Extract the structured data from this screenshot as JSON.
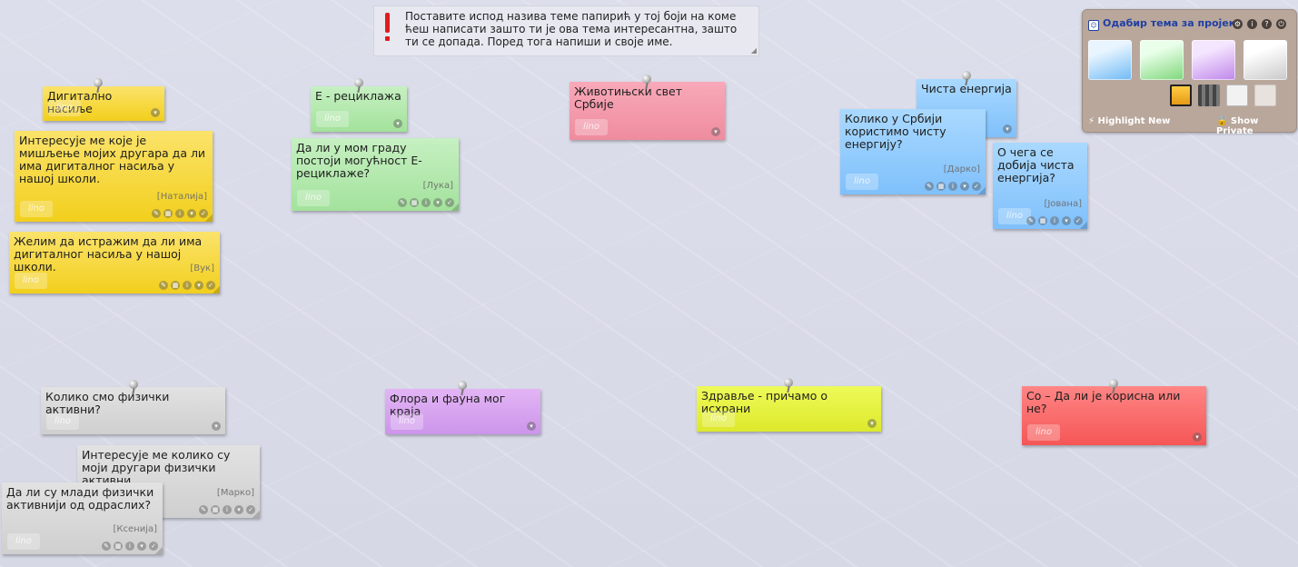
{
  "instruction": {
    "text": "Поставите испод назива теме папирић у тој боји на коме ћеш написати зашто ти је ова тема интересантна, зашто ти се допада. Поред тога напиши и своје име."
  },
  "panel": {
    "title": "Одабир тема за пројека",
    "highlight_label": "⚡ Highlight New",
    "private_label": "🔒 Show Private"
  },
  "notes": {
    "dig_title": {
      "text": "Дигитално насиље"
    },
    "dig_1": {
      "text": "Интересује ме које је мишљење мојих другара да ли има дигиталног насиља у нашој школи.",
      "author": "[Наталија]"
    },
    "dig_2": {
      "text": "Желим да истражим да ли има дигиталног насиља у нашој школи.",
      "author": "[Вук]"
    },
    "eco_title": {
      "text": "Е - рециклажа"
    },
    "eco_1": {
      "text": "Да ли у мом граду постоји могућност Е-рециклаже?",
      "author": "[Лука]"
    },
    "animal_title": {
      "text": "Животињски свет Србије"
    },
    "energy_title": {
      "text": "Чиста енергија"
    },
    "energy_1": {
      "text": "Колико у Србији користимо чисту енергију?",
      "author": "[Дарко]"
    },
    "energy_2": {
      "text": "О чега се добија чиста енергија?",
      "author": "[Јована]"
    },
    "phys_title": {
      "text": "Колико смо физички активни?"
    },
    "phys_1": {
      "text": "Интересује ме колико су моји другари физички активни.",
      "author": "[Марко]"
    },
    "phys_2": {
      "text": "Да ли су млади физички активнији од одраслих?",
      "author": "[Ксенија]"
    },
    "flora_title": {
      "text": "Флора и фауна мог краја"
    },
    "health_title": {
      "text": "Здравље - причамо о исхрани"
    },
    "salt_title": {
      "text": "Со – Да ли је корисна или не?"
    }
  },
  "logo_text": "lino",
  "colors": {
    "yellow": "#f2cf1c",
    "green": "#a3e29c",
    "pink": "#ef8c9f",
    "blue": "#7fc0fb",
    "gray": "#cfcfcf",
    "purple": "#cc95ea",
    "lime": "#dde92b",
    "red": "#f55656"
  }
}
